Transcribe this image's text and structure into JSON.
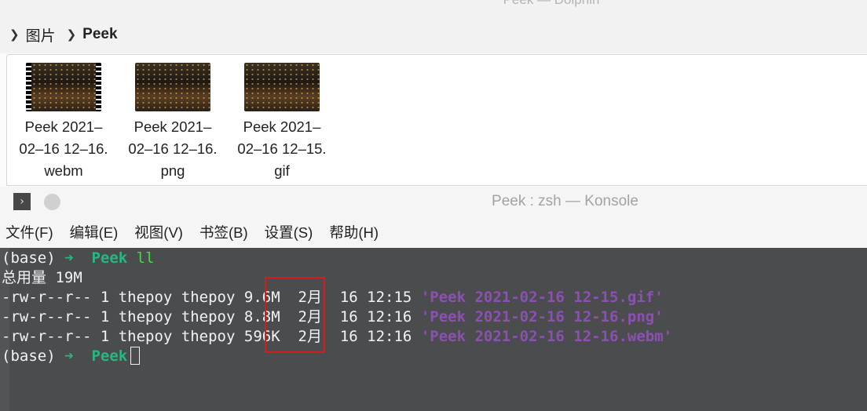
{
  "dolphin": {
    "title_fragment": "Peek — Dolphin",
    "breadcrumb": [
      "图片",
      "Peek"
    ],
    "files": [
      {
        "name_lines": [
          "Peek 2021–",
          "02–16 12–16.",
          "webm"
        ],
        "has_film_strip": true
      },
      {
        "name_lines": [
          "Peek 2021–",
          "02–16 12–16.",
          "png"
        ],
        "has_film_strip": false
      },
      {
        "name_lines": [
          "Peek 2021–",
          "02–16 12–15.",
          "gif"
        ],
        "has_film_strip": false
      }
    ]
  },
  "konsole": {
    "title": "Peek : zsh — Konsole",
    "icon": "terminal-icon",
    "menu": [
      "文件(F)",
      "编辑(E)",
      "视图(V)",
      "书签(B)",
      "设置(S)",
      "帮助(H)"
    ],
    "lines": {
      "prompt_base": "(base)",
      "arrow": "➜",
      "dir": "Peek",
      "command": "ll",
      "total": "总用量 19M",
      "entries": [
        {
          "perms": "-rw-r--r-- 1 thepoy thepoy",
          "size": "9.6M",
          "date": "2月  16 12:15",
          "name": "'Peek 2021-02-16 12-15.gif'"
        },
        {
          "perms": "-rw-r--r-- 1 thepoy thepoy",
          "size": "8.8M",
          "date": "2月  16 12:16",
          "name": "'Peek 2021-02-16 12-16.png'"
        },
        {
          "perms": "-rw-r--r-- 1 thepoy thepoy",
          "size": "596K",
          "date": "2月  16 12:16",
          "name": "'Peek 2021-02-16 12-16.webm'"
        }
      ]
    }
  },
  "colors": {
    "terminal_bg": "#4b4c4e",
    "prompt_green": "#27b880",
    "filename_purple": "#8c4fb3",
    "highlight_red": "#d81b1b"
  }
}
